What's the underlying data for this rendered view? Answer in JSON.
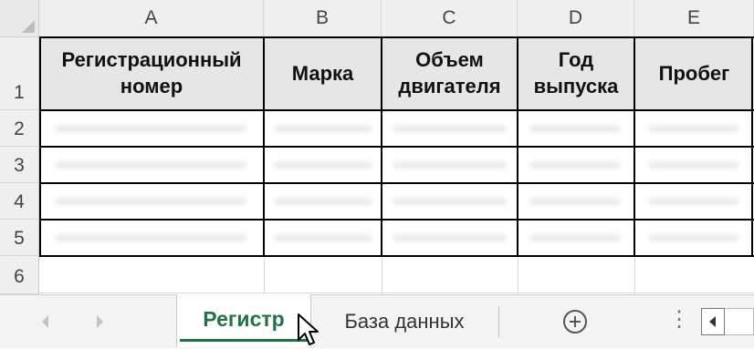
{
  "columns": [
    "A",
    "B",
    "C",
    "D",
    "E"
  ],
  "rows": [
    "1",
    "2",
    "3",
    "4",
    "5",
    "6"
  ],
  "table_header": {
    "a": "Регистрационный номер",
    "b": "Марка",
    "c": "Объем двигателя",
    "d": "Год выпуска",
    "e": "Пробег"
  },
  "sheet_tabs": {
    "active": "Регистр",
    "second": "База данных"
  },
  "colors": {
    "accent": "#217346",
    "header_fill": "#e6e6e6"
  },
  "icons": {
    "add_sheet": "plus-circle-icon",
    "more": "ellipsis-icon",
    "cursor": "pointer-cursor-icon"
  }
}
